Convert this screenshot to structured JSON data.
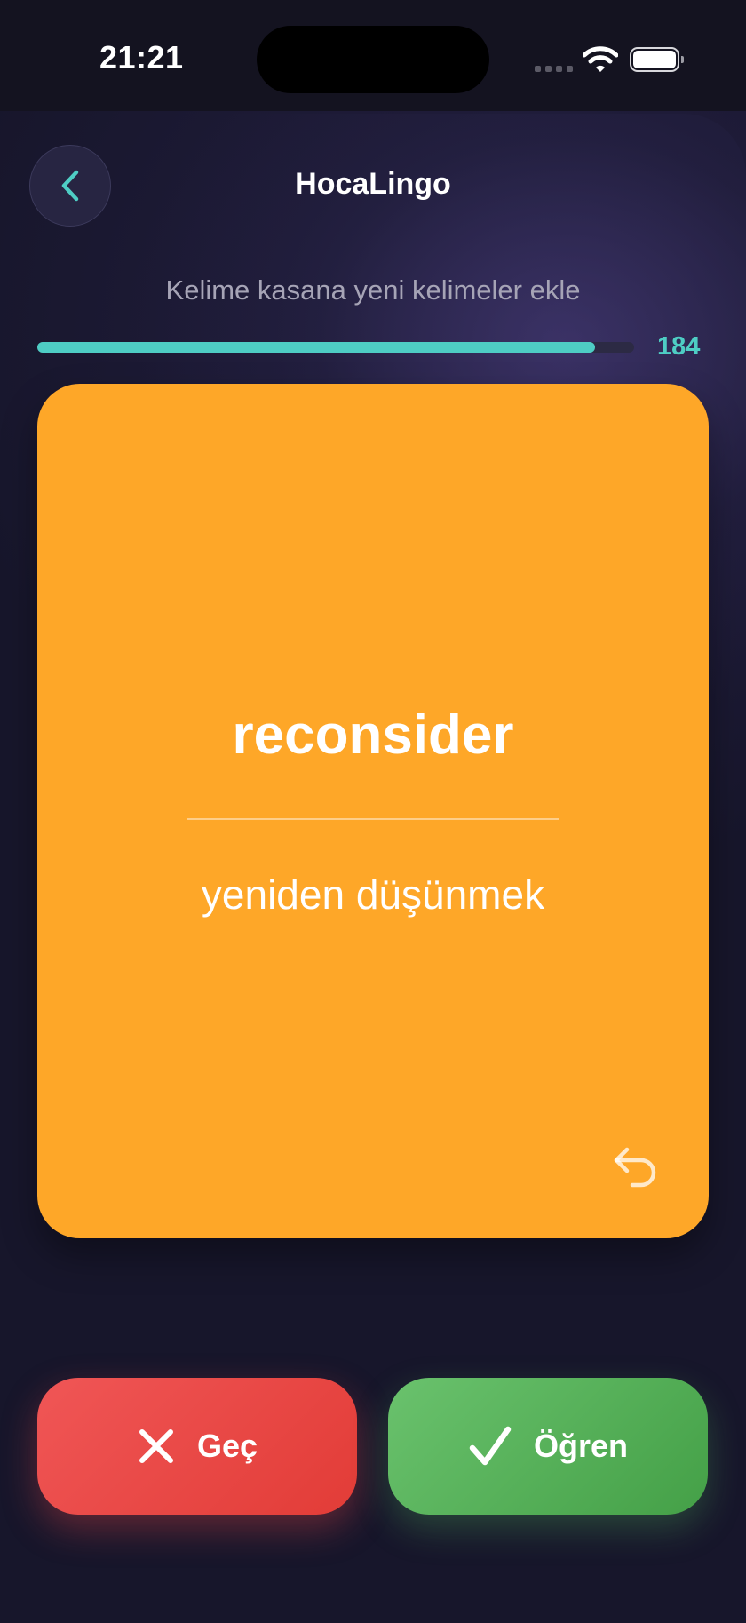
{
  "status_bar": {
    "time": "21:21"
  },
  "header": {
    "title": "HocaLingo",
    "back_icon": "chevron-left-icon"
  },
  "subtitle": "Kelime kasana yeni kelimeler ekle",
  "progress": {
    "count": "184",
    "fraction": 0.935
  },
  "card": {
    "word": "reconsider",
    "translation": "yeniden düşünmek",
    "background_color": "#fea728",
    "flip_icon": "undo-arrow-icon"
  },
  "actions": {
    "skip_label": "Geç",
    "skip_icon": "close-icon",
    "learn_label": "Öğren",
    "learn_icon": "checkmark-icon"
  },
  "colors": {
    "accent": "#4ecdc4",
    "skip": "#e8474a",
    "learn": "#55ad58"
  }
}
